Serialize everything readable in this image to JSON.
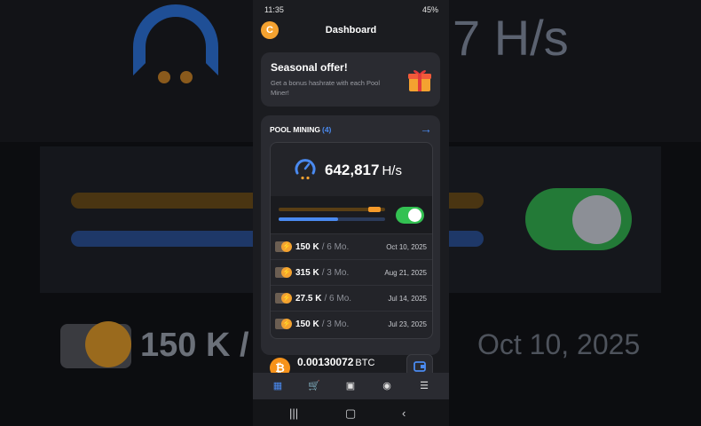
{
  "status_bar": {
    "time": "11:35",
    "battery": "45%"
  },
  "app": {
    "title": "Dashboard",
    "logo_letter": "C"
  },
  "offer": {
    "title": "Seasonal offer!",
    "text": "Get a bonus hashrate with each Pool Miner!",
    "icon": "gift-icon"
  },
  "pool": {
    "title": "POOL MINING",
    "count": "(4)",
    "hashrate_value": "642,817",
    "hashrate_unit": "H/s",
    "toggle_on": true,
    "progress_orange": 0.96,
    "progress_blue": 0.56,
    "miners": [
      {
        "amount": "150 K",
        "duration": "/ 6 Mo.",
        "date": "Oct 10, 2025"
      },
      {
        "amount": "315 K",
        "duration": "/ 3 Mo.",
        "date": "Aug 21, 2025"
      },
      {
        "amount": "27.5 K",
        "duration": "/ 6 Mo.",
        "date": "Jul 14, 2025"
      },
      {
        "amount": "150 K",
        "duration": "/ 3 Mo.",
        "date": "Jul 23, 2025"
      }
    ]
  },
  "balance": {
    "value": "0.00130072",
    "currency": "BTC"
  },
  "bottom_nav": [
    "grid-icon",
    "cart-icon",
    "wallet-icon",
    "coin-icon",
    "menu-icon"
  ],
  "colors": {
    "accent_blue": "#4a8af0",
    "accent_orange": "#f4a230",
    "toggle_green": "#33c152"
  },
  "background": {
    "hashrate_fragment": "7 H/s",
    "amount": "150 K",
    "separator": "/",
    "date": "Oct 10, 2025"
  }
}
